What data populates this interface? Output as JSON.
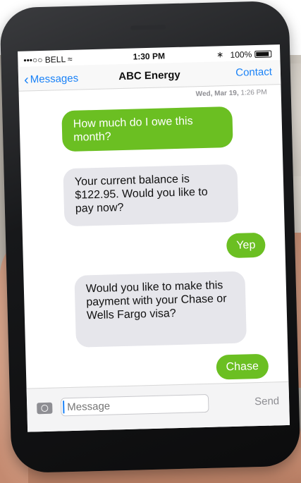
{
  "status_bar": {
    "carrier": "•••○○ BELL ≈",
    "time": "1:30 PM",
    "bluetooth": "∗",
    "battery": "100%"
  },
  "nav": {
    "back_label": "Messages",
    "title": "ABC Energy",
    "contact_label": "Contact"
  },
  "thread": {
    "timestamp_day": "Wed, Mar 19,",
    "timestamp_time": "1:26 PM",
    "messages": [
      {
        "from": "me",
        "text": "How much do I owe this month?"
      },
      {
        "from": "them",
        "text": "Your current balance is $122.95. Would you like to pay now?"
      },
      {
        "from": "me",
        "text": "Yep"
      },
      {
        "from": "them",
        "text": "Would you like to make this payment with your Chase or Wells Fargo visa?"
      },
      {
        "from": "me",
        "text": "Chase"
      }
    ]
  },
  "composer": {
    "placeholder": "Message",
    "send_label": "Send"
  },
  "colors": {
    "outgoing": "#6bbf22",
    "incoming": "#e6e6eb",
    "ios_blue": "#1a82f7"
  }
}
